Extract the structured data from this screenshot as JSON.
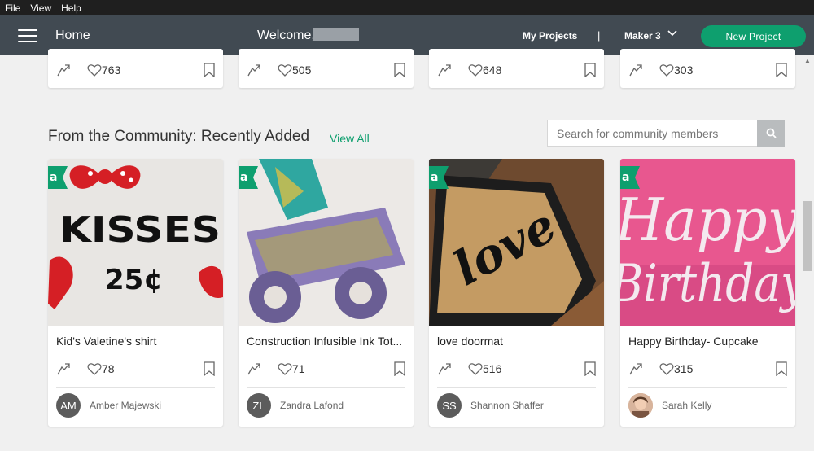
{
  "menu": [
    "File",
    "View",
    "Help"
  ],
  "header": {
    "home": "Home",
    "welcome": "Welcome,",
    "my_projects": "My Projects",
    "separator": "|",
    "machine": "Maker 3",
    "new_project": "New Project"
  },
  "top_cards": [
    {
      "likes": "763"
    },
    {
      "likes": "505"
    },
    {
      "likes": "648"
    },
    {
      "likes": "303"
    }
  ],
  "community": {
    "title": "From the Community: Recently Added",
    "view_all": "View All",
    "search_placeholder": "Search for community members",
    "cards": [
      {
        "title": "Kid's Valetine's shirt",
        "likes": "78",
        "user": "Amber Majewski",
        "initials": "AM"
      },
      {
        "title": "Construction Infusible Ink Tot...",
        "likes": "71",
        "user": "Zandra Lafond",
        "initials": "ZL"
      },
      {
        "title": "love doormat",
        "likes": "516",
        "user": "Shannon Shaffer",
        "initials": "SS"
      },
      {
        "title": "Happy Birthday- Cupcake",
        "likes": "315",
        "user": "Sarah Kelly",
        "initials": ""
      }
    ]
  },
  "image_text": {
    "kisses": "KISSES",
    "price": "25¢",
    "love": "love",
    "happy": "Happy",
    "birthday": "Birthday"
  },
  "colors": {
    "accent": "#0e9f6e",
    "header": "#414a52"
  }
}
